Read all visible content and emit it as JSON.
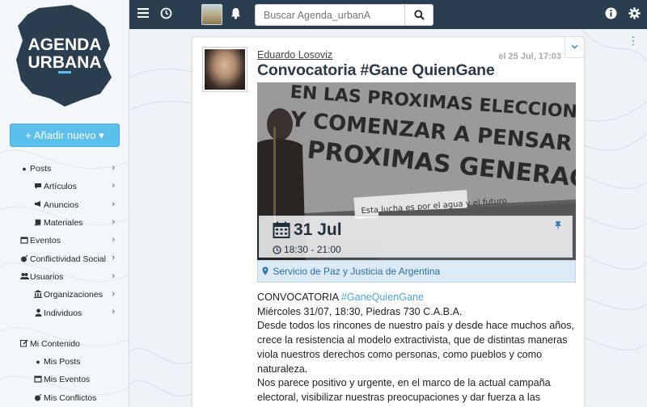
{
  "brand": {
    "logo_line1": "AGENDA",
    "logo_line2": "URBANA",
    "accent": "#5bc0eb",
    "dark": "#2b3e50"
  },
  "sidebar": {
    "add_button": "+ Añadir nuevo ▾",
    "items": [
      {
        "label": "Posts",
        "icon": "circle-icon",
        "level": 0
      },
      {
        "label": "Artículos",
        "icon": "comment-icon",
        "level": 1
      },
      {
        "label": "Anuncios",
        "icon": "bullhorn-icon",
        "level": 1
      },
      {
        "label": "Materiales",
        "icon": "book-icon",
        "level": 1
      },
      {
        "label": "Eventos",
        "icon": "calendar-icon",
        "level": 0
      },
      {
        "label": "Conflictividad Social",
        "icon": "bomb-icon",
        "level": 0
      },
      {
        "label": "Usuarios",
        "icon": "users-icon",
        "level": 0
      },
      {
        "label": "Organizaciones",
        "icon": "institution-icon",
        "level": 1
      },
      {
        "label": "Individuos",
        "icon": "user-icon",
        "level": 1
      }
    ],
    "my_content": [
      {
        "label": "Mi Contenido",
        "icon": "edit-icon",
        "level": 0
      },
      {
        "label": "Mis Posts",
        "icon": "circle-icon",
        "level": 1
      },
      {
        "label": "Mis Eventos",
        "icon": "calendar-icon",
        "level": 1
      },
      {
        "label": "Mis Conflictos",
        "icon": "bomb-icon",
        "level": 1
      }
    ]
  },
  "topbar": {
    "search_placeholder": "Buscar Agenda_urbanA"
  },
  "post": {
    "author": "Eduardo Losoviz",
    "date": "el 25 Jul, 17:03",
    "title": "Convocatoria #Gane QuienGane",
    "hero_text_lines": [
      "EN LAS PROXIMAS ELECCIONES",
      "Y COMENZAR A PENSAR EN LAS",
      "PROXIMAS GENERACIONES"
    ],
    "hero_banner": "Esta lucha es por el agua  y el futuro",
    "event_day": "31 Jul",
    "event_time": "18:30 - 21:00",
    "location": "Servicio de Paz y Justicia de Argentina",
    "body": {
      "line1_prefix": "CONVOCATORIA ",
      "line1_hashtag": "#GaneQuienGane",
      "line2": "Miércoles 31/07, 18:30, Piedras 730 C.A.B.A.",
      "para1": "Desde todos los rincones de nuestro país y desde hace muchos años, crece la resistencia al modelo extractivista, que de distintas maneras viola nuestros derechos como personas, como pueblos y como naturaleza.",
      "para2": "Nos parece positivo y urgente, en el marco de la actual campaña electoral, visibilizar nuestras preocupaciones  y dar fuerza a las"
    }
  }
}
